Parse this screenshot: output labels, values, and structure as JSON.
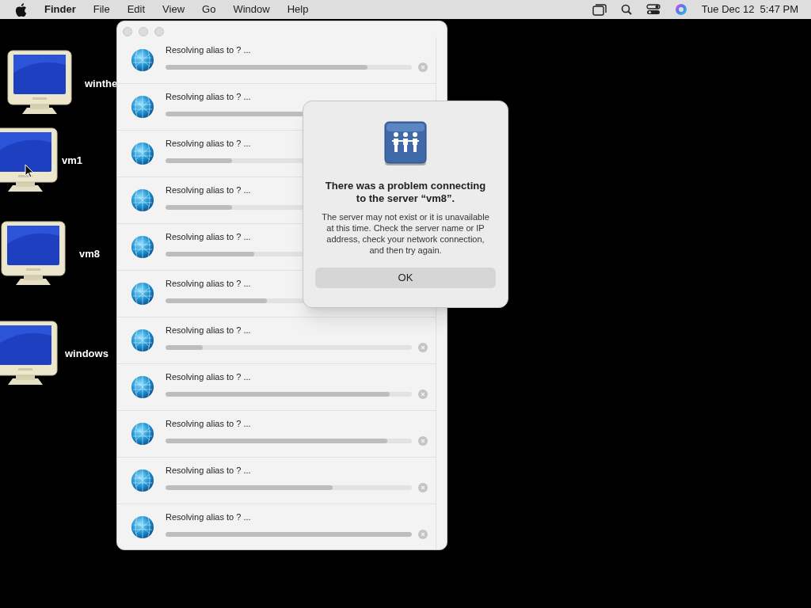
{
  "menu_bar": {
    "app": "Finder",
    "menus": [
      "File",
      "Edit",
      "View",
      "Go",
      "Window",
      "Help"
    ],
    "clock": "Tue Dec 12  5:47 PM"
  },
  "desktop_icons": [
    {
      "label": "winthe"
    },
    {
      "label": "vm1"
    },
    {
      "label": "vm8"
    },
    {
      "label": "windows"
    }
  ],
  "progress_window": {
    "items": [
      {
        "title": "Resolving alias to ? ...",
        "level": 0.82,
        "stop_button": true
      },
      {
        "title": "Resolving alias to ? ...",
        "level": 0.8,
        "stop_button": false
      },
      {
        "title": "Resolving alias to ? ...",
        "level": 0.27,
        "stop_button": false
      },
      {
        "title": "Resolving alias to ? ...",
        "level": 0.27,
        "stop_button": false
      },
      {
        "title": "Resolving alias to ? ...",
        "level": 0.36,
        "stop_button": false
      },
      {
        "title": "Resolving alias to ? ...",
        "level": 0.41,
        "stop_button": false
      },
      {
        "title": "Resolving alias to ? ...",
        "level": 0.15,
        "stop_button": true
      },
      {
        "title": "Resolving alias to ? ...",
        "level": 0.91,
        "stop_button": true
      },
      {
        "title": "Resolving alias to ? ...",
        "level": 0.9,
        "stop_button": true
      },
      {
        "title": "Resolving alias to ? ...",
        "level": 0.68,
        "stop_button": true
      },
      {
        "title": "Resolving alias to ? ...",
        "level": 1,
        "stop_button": true
      }
    ]
  },
  "alert": {
    "title": "There was a problem connecting to the server “vm8”.",
    "message": "The server may not exist or it is unavailable at this time. Check the server name or IP address, check your network connection, and then try again.",
    "button": "OK"
  }
}
